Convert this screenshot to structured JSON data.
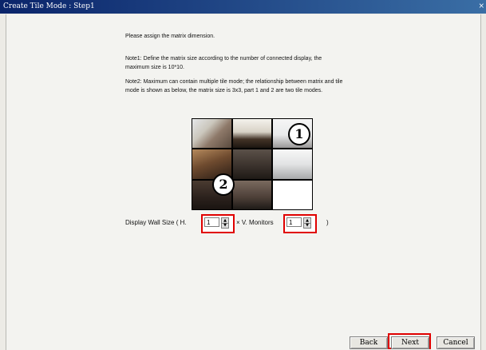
{
  "window": {
    "title": "Create Tile Mode : Step1",
    "close_glyph": "×"
  },
  "content": {
    "instruction": "Please assign the matrix dimension.",
    "note1_line1": "Note1: Define the matrix size according to the number of connected display, the",
    "note1_line2": "maximum size is 10*10.",
    "note2_line1": "Note2: Maximum can contain multiple tile mode; the relationship between matrix and tile",
    "note2_line2": "mode is shown as below, the matrix size is 3x3, part 1 and 2 are two tile modes."
  },
  "illustration": {
    "badge1": "1",
    "badge2": "2"
  },
  "wall_size": {
    "label": "Display Wall Size ( H.",
    "h_value": "1",
    "times_label": "× V. Monitors",
    "v_value": "1",
    "close_paren": ")"
  },
  "buttons": {
    "back": "Back",
    "next": "Next",
    "cancel": "Cancel"
  },
  "colors": {
    "titlebar": "#0a246a",
    "highlight": "#e00000"
  }
}
